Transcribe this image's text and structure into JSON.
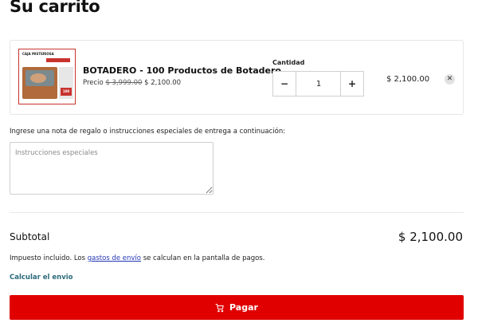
{
  "page": {
    "title": "Su carrito"
  },
  "cart": {
    "item": {
      "thumbnail": {
        "brand_text": "CAJA MISTERIOSA",
        "badge_text": "100"
      },
      "name": "BOTADERO - 100 Productos de Botadero",
      "price_label": "Precio",
      "old_price": "$ 3,999.00",
      "new_price": "$ 2,100.00",
      "quantity_label": "Cantidad",
      "quantity": "1",
      "minus_label": "−",
      "plus_label": "+",
      "line_total": "$ 2,100.00",
      "remove_label": "✕"
    }
  },
  "note": {
    "label": "Ingrese una nota de regalo o instrucciones especiales de entrega a continuación:",
    "placeholder": "Instrucciones especiales"
  },
  "summary": {
    "subtotal_label": "Subtotal",
    "subtotal_value": "$ 2,100.00",
    "tax_prefix": "Impuesto incluido. Los ",
    "tax_link": "gastos de envío",
    "tax_suffix": " se calculan en la pantalla de pagos.",
    "calc_shipping": "Calcular el envio"
  },
  "checkout": {
    "pay_label": "Pagar",
    "icon": "cart-icon"
  },
  "colors": {
    "pay_button": "#e00000",
    "link": "#2437b5",
    "calc_link": "#2a6a7a"
  }
}
